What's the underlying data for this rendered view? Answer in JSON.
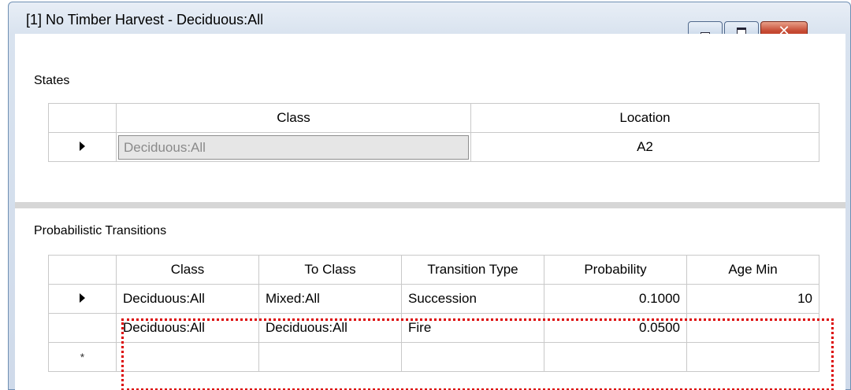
{
  "window": {
    "title": "[1] No Timber Harvest - Deciduous:All",
    "controls": {
      "minimize_icon": "minimize-icon",
      "maximize_icon": "maximize-icon",
      "close_glyph": "✕"
    }
  },
  "states": {
    "label": "States",
    "columns": [
      "Class",
      "Location"
    ],
    "rows": [
      {
        "class": "Deciduous:All",
        "location": "A2"
      }
    ]
  },
  "transitions": {
    "label": "Probabilistic Transitions",
    "columns": [
      "Class",
      "To Class",
      "Transition Type",
      "Probability",
      "Age Min"
    ],
    "rows": [
      {
        "class": "Deciduous:All",
        "to_class": "Mixed:All",
        "type": "Succession",
        "probability": "0.1000",
        "age_min": "10"
      },
      {
        "class": "Deciduous:All",
        "to_class": "Deciduous:All",
        "type": "Fire",
        "probability": "0.0500",
        "age_min": ""
      }
    ],
    "new_row_marker": "*"
  },
  "colors": {
    "highlight_border": "#dc0000",
    "grid_line": "#c9c9c9",
    "readonly_cell": "#e6e6e6"
  }
}
